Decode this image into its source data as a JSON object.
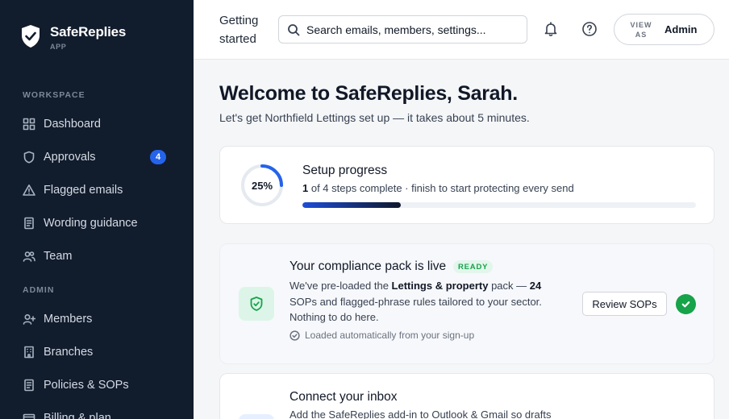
{
  "brand": {
    "name": "SafeReplies",
    "sub": "APP"
  },
  "sidebar": {
    "workspace_label": "WORKSPACE",
    "workspace_items": [
      {
        "label": "Dashboard",
        "icon": "grid-icon"
      },
      {
        "label": "Approvals",
        "icon": "shield-icon",
        "badge": "4"
      },
      {
        "label": "Flagged emails",
        "icon": "warning-icon"
      },
      {
        "label": "Wording guidance",
        "icon": "document-icon"
      },
      {
        "label": "Team",
        "icon": "people-icon"
      }
    ],
    "admin_label": "ADMIN",
    "admin_items": [
      {
        "label": "Members",
        "icon": "user-plus-icon"
      },
      {
        "label": "Branches",
        "icon": "building-icon"
      },
      {
        "label": "Policies & SOPs",
        "icon": "document-icon"
      },
      {
        "label": "Billing & plan",
        "icon": "card-icon"
      }
    ]
  },
  "header": {
    "title": "Getting started",
    "search_placeholder": "Search emails, members, settings...",
    "view_as_label": "VIEW AS",
    "view_as_value": "Admin"
  },
  "main": {
    "welcome": "Welcome to SafeReplies, Sarah.",
    "welcome_sub": "Let's get Northfield Lettings set up — it takes about 5 minutes.",
    "progress": {
      "percent_label": "25%",
      "percent": 25,
      "title": "Setup progress",
      "steps_done": "1",
      "steps_rest": " of 4 steps complete · finish to start protecting every send"
    },
    "pack": {
      "title": "Your compliance pack is live",
      "status": "READY",
      "desc_1": "We've pre-loaded the ",
      "desc_bold_1": "Lettings & property",
      "desc_2": " pack — ",
      "desc_bold_2": "24",
      "desc_3": " SOPs and flagged-phrase rules tailored to your sector. Nothing to do here.",
      "note": "Loaded automatically from your sign-up",
      "button": "Review SOPs"
    },
    "inbox": {
      "title": "Connect your inbox",
      "desc": "Add the SafeReplies add-in to Outlook & Gmail so drafts"
    }
  },
  "colors": {
    "sidebar_bg": "#111c2d",
    "accent": "#2563eb",
    "success": "#16a34a"
  }
}
